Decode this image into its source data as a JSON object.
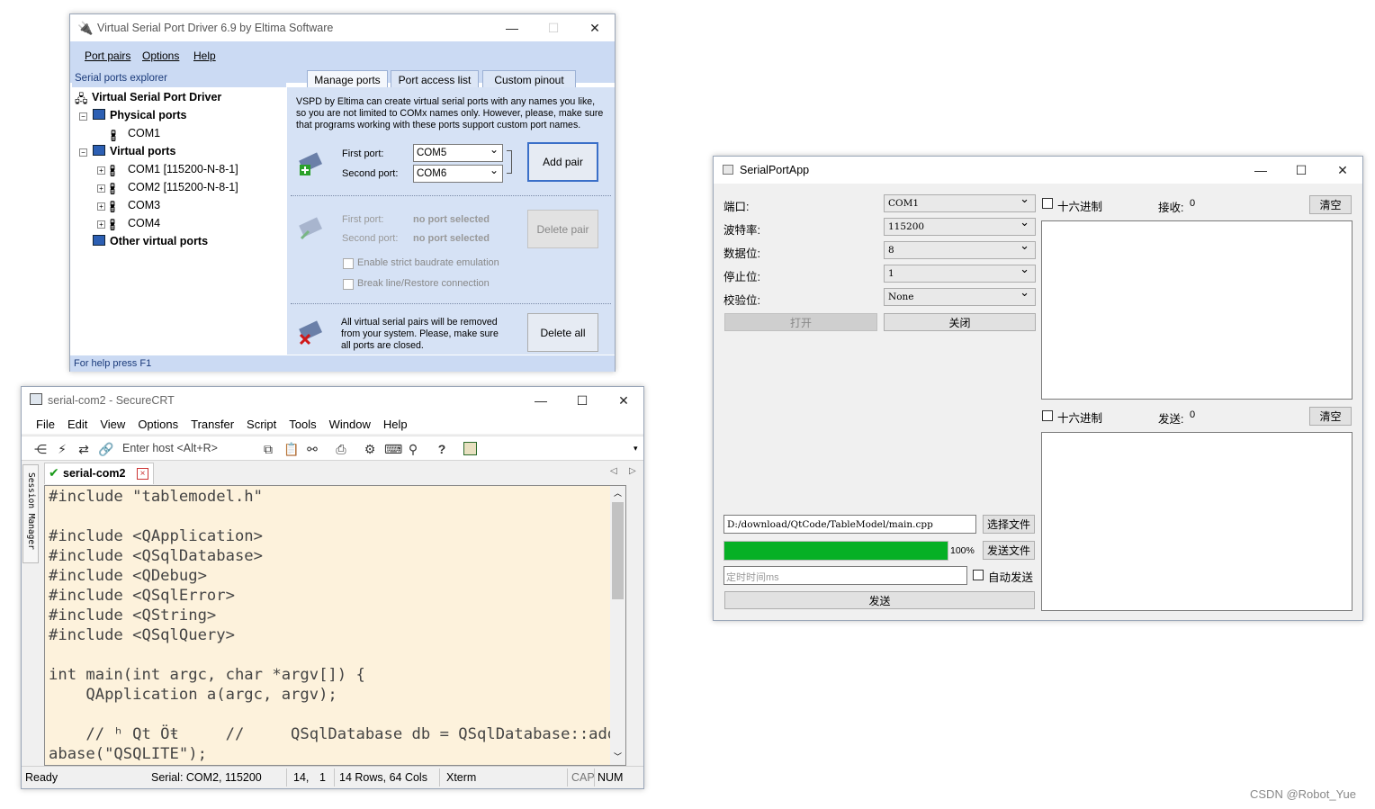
{
  "vspd": {
    "title": "Virtual Serial Port Driver 6.9 by Eltima Software",
    "menu": {
      "port_pairs": "Port pairs",
      "options": "Options",
      "help": "Help"
    },
    "explorer_title": "Serial ports explorer",
    "tree": {
      "root": "Virtual Serial Port Driver",
      "physical": "Physical ports",
      "physical_com1": "COM1",
      "virtual": "Virtual ports",
      "v1": "COM1 [115200-N-8-1]",
      "v2": "COM2 [115200-N-8-1]",
      "v3": "COM3",
      "v4": "COM4",
      "other": "Other virtual ports"
    },
    "tabs": {
      "manage": "Manage ports",
      "access": "Port access list",
      "pinout": "Custom pinout"
    },
    "intro": "VSPD by Eltima can create virtual serial ports with any names you like, so you are not limited to COMx names only. However, please, make sure that programs working with these ports support custom port names.",
    "add": {
      "first_label": "First port:",
      "first_value": "COM5",
      "second_label": "Second port:",
      "second_value": "COM6",
      "button": "Add pair"
    },
    "del": {
      "first_label": "First port:",
      "first_value": "no port selected",
      "second_label": "Second port:",
      "second_value": "no port selected",
      "button": "Delete pair",
      "strict": "Enable strict baudrate emulation",
      "break": "Break line/Restore connection"
    },
    "delall": {
      "text": "All virtual serial pairs will be removed from your system. Please, make sure all ports are closed.",
      "button": "Delete all"
    },
    "status": "For help press F1"
  },
  "crt": {
    "title": "serial-com2 - SecureCRT",
    "menu": [
      "File",
      "Edit",
      "View",
      "Options",
      "Transfer",
      "Script",
      "Tools",
      "Window",
      "Help"
    ],
    "host_placeholder": "Enter host <Alt+R>",
    "session_manager": "Session Manager",
    "tab": "serial-com2",
    "terminal": "#include \"tablemodel.h\"\n\n#include <QApplication>\n#include <QSqlDatabase>\n#include <QDebug>\n#include <QSqlError>\n#include <QString>\n#include <QSqlQuery>\n\nint main(int argc, char *argv[]) {\n    QApplication a(argc, argv);\n\n    // ʰ Qt Öŧ     //     QSqlDatabase db = QSqlDatabase::addDat\nabase(\"QSQLITE\");",
    "status": {
      "ready": "Ready",
      "serial": "Serial: COM2, 115200",
      "row": "14,",
      "col": "1",
      "size": "14 Rows, 64 Cols",
      "term": "Xterm",
      "cap": "CAP",
      "num": "NUM"
    }
  },
  "spa": {
    "title": "SerialPortApp",
    "port_label": "端口:",
    "port_value": "COM1",
    "baud_label": "波特率:",
    "baud_value": "115200",
    "data_label": "数据位:",
    "data_value": "8",
    "stop_label": "停止位:",
    "stop_value": "1",
    "parity_label": "校验位:",
    "parity_value": "None",
    "open": "打开",
    "close": "关闭",
    "hex_rx": "十六进制",
    "rx_label": "接收:",
    "rx_count": "0",
    "clear_rx": "清空",
    "hex_tx": "十六进制",
    "tx_label": "发送:",
    "tx_count": "0",
    "clear_tx": "清空",
    "file_path": "D:/download/QtCode/TableModel/main.cpp",
    "choose_file": "选择文件",
    "progress": 100,
    "progress_text": "100%",
    "send_file": "发送文件",
    "timer_placeholder": "定时时间ms",
    "auto_send": "自动发送",
    "send": "发送"
  },
  "watermark": "CSDN @Robot_Yue"
}
